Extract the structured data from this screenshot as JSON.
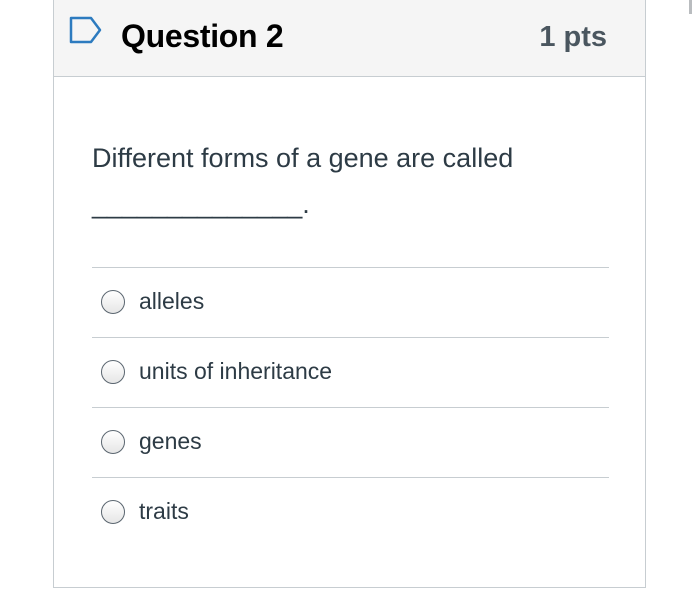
{
  "question": {
    "title": "Question 2",
    "points": "1 pts",
    "flag_icon": "bookmark-flag-icon",
    "text_line1": "Different forms of a gene are called",
    "text_line2": "______________."
  },
  "answers": [
    {
      "label": "alleles",
      "selected": false
    },
    {
      "label": "units of inheritance",
      "selected": false
    },
    {
      "label": "genes",
      "selected": false
    },
    {
      "label": "traits",
      "selected": false
    }
  ],
  "colors": {
    "header_bg": "#f5f5f5",
    "border": "#c7cdd1",
    "flag": "#2d7bbf",
    "text": "#2d3b45"
  }
}
